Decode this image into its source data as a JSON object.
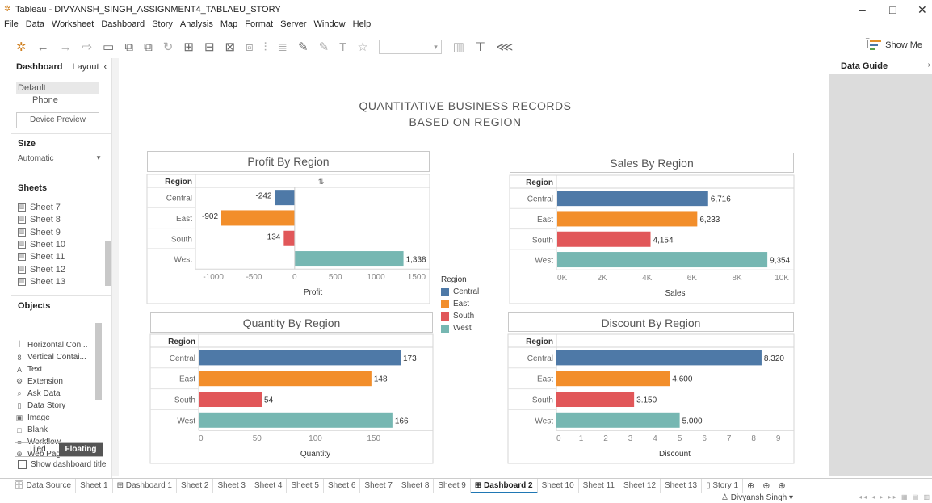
{
  "window": {
    "title": "Tableau - DIVYANSH_SINGH_ASSIGNMENT4_TABLAEU_STORY",
    "minimize": "–",
    "maximize": "□",
    "close": "✕"
  },
  "menu": [
    "File",
    "Data",
    "Worksheet",
    "Dashboard",
    "Story",
    "Analysis",
    "Map",
    "Format",
    "Server",
    "Window",
    "Help"
  ],
  "toolbar": {
    "icons": [
      "tableau-logo-icon",
      "back-icon",
      "forward-icon",
      "new-datasource-icon",
      "save-icon",
      "new-sheet-icon",
      "duplicate-sheet-icon",
      "refresh-icon",
      "swap-icon",
      "sort-icon",
      "clear-icon",
      "group-icon",
      "label-icon",
      "highlight-icon",
      "fix-axes-icon",
      "text-icon",
      "pin-icon",
      "fit-icon",
      "presentation-icon",
      "share-icon"
    ],
    "show_me": "Show Me"
  },
  "left_panel": {
    "tabs": [
      "Dashboard",
      "Layout"
    ],
    "device": [
      "Default",
      "Phone"
    ],
    "device_preview": "Device Preview",
    "size_label": "Size",
    "size_value": "Automatic",
    "sheets_label": "Sheets",
    "sheets": [
      "Sheet 7",
      "Sheet 8",
      "Sheet 9",
      "Sheet 10",
      "Sheet 11",
      "Sheet 12",
      "Sheet 13"
    ],
    "objects_label": "Objects",
    "objects": [
      {
        "icon": "ꟾ",
        "label": "Horizontal Con..."
      },
      {
        "icon": "8",
        "label": "Vertical Contai..."
      },
      {
        "icon": "A",
        "label": "Text"
      },
      {
        "icon": "⚙",
        "label": "Extension"
      },
      {
        "icon": "⌕",
        "label": "Ask Data"
      },
      {
        "icon": "▯",
        "label": "Data Story"
      },
      {
        "icon": "▣",
        "label": "Image"
      },
      {
        "icon": "□",
        "label": "Blank"
      },
      {
        "icon": "≡",
        "label": "Workflow"
      },
      {
        "icon": "⊕",
        "label": "Web Page"
      }
    ],
    "tiled": "Tiled",
    "floating": "Floating",
    "show_title": "Show dashboard title"
  },
  "dashboard": {
    "title_line1": "QUANTITATIVE BUSINESS RECORDS",
    "title_line2": "BASED ON REGION"
  },
  "colors": {
    "Central": "#4e79a7",
    "East": "#f28e2b",
    "South": "#e15759",
    "West": "#76b7b2"
  },
  "chart_data": [
    {
      "type": "bar",
      "title": "Profit By Region",
      "row_header": "Region",
      "categories": [
        "Central",
        "East",
        "South",
        "West"
      ],
      "values": [
        -242,
        -902,
        -134,
        1338
      ],
      "labels": [
        "-242",
        "-902",
        "-134",
        "1,338"
      ],
      "xlabel": "Profit",
      "xlim": [
        -1200,
        1650
      ],
      "ticks": [
        -1000,
        -500,
        0,
        500,
        1000,
        1500
      ],
      "tick_labels": [
        "-1000",
        "-500",
        "0",
        "500",
        "1000",
        "1500"
      ]
    },
    {
      "type": "bar",
      "title": "Sales By Region",
      "row_header": "Region",
      "categories": [
        "Central",
        "East",
        "South",
        "West"
      ],
      "values": [
        6716,
        6233,
        4154,
        9354
      ],
      "labels": [
        "6,716",
        "6,233",
        "4,154",
        "9,354"
      ],
      "xlabel": "Sales",
      "xlim": [
        0,
        10500
      ],
      "ticks": [
        0,
        2000,
        4000,
        6000,
        8000,
        10000
      ],
      "tick_labels": [
        "0K",
        "2K",
        "4K",
        "6K",
        "8K",
        "10K"
      ]
    },
    {
      "type": "bar",
      "title": "Quantity By Region",
      "row_header": "Region",
      "categories": [
        "Central",
        "East",
        "South",
        "West"
      ],
      "values": [
        173,
        148,
        54,
        166
      ],
      "labels": [
        "173",
        "148",
        "54",
        "166"
      ],
      "xlabel": "Quantity",
      "xlim": [
        0,
        200
      ],
      "ticks": [
        0,
        50,
        100,
        150
      ],
      "tick_labels": [
        "0",
        "50",
        "100",
        "150"
      ]
    },
    {
      "type": "bar",
      "title": "Discount By Region",
      "row_header": "Region",
      "categories": [
        "Central",
        "East",
        "South",
        "West"
      ],
      "values": [
        8.32,
        4.6,
        3.15,
        5.0
      ],
      "labels": [
        "8.320",
        "4.600",
        "3.150",
        "5.000"
      ],
      "xlabel": "Discount",
      "xlim": [
        0,
        9.6
      ],
      "ticks": [
        0,
        1,
        2,
        3,
        4,
        5,
        6,
        7,
        8,
        9
      ],
      "tick_labels": [
        "0",
        "1",
        "2",
        "3",
        "4",
        "5",
        "6",
        "7",
        "8",
        "9"
      ]
    }
  ],
  "legend": {
    "title": "Region",
    "items": [
      "Central",
      "East",
      "South",
      "West"
    ]
  },
  "data_guide": {
    "title": "Data Guide"
  },
  "bottom_tabs": [
    {
      "label": "Data Source",
      "icon": "🗄"
    },
    {
      "label": "Sheet 1"
    },
    {
      "label": "Dashboard 1",
      "icon": "⊞"
    },
    {
      "label": "Sheet 2"
    },
    {
      "label": "Sheet 3"
    },
    {
      "label": "Sheet 4"
    },
    {
      "label": "Sheet 5"
    },
    {
      "label": "Sheet 6"
    },
    {
      "label": "Sheet 7"
    },
    {
      "label": "Sheet 8"
    },
    {
      "label": "Sheet 9"
    },
    {
      "label": "Dashboard 2",
      "icon": "⊞",
      "active": true
    },
    {
      "label": "Sheet 10"
    },
    {
      "label": "Sheet 11"
    },
    {
      "label": "Sheet 12"
    },
    {
      "label": "Sheet 13"
    },
    {
      "label": "Story 1",
      "icon": "▯"
    }
  ],
  "status": {
    "user": "Divyansh Singh"
  }
}
